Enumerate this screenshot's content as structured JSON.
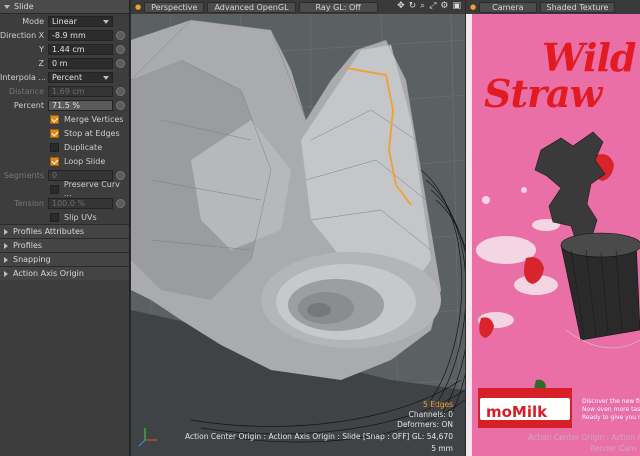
{
  "panel": {
    "title": "Slide",
    "mode": {
      "label": "Mode",
      "value": "Linear"
    },
    "direction": {
      "label": "Direction X",
      "x": "-8.9 mm",
      "y_label": "Y",
      "y": "1.44 cm",
      "z_label": "Z",
      "z": "0 m"
    },
    "interpolation": {
      "label": "Interpola ...",
      "value": "Percent"
    },
    "distance": {
      "label": "Distance",
      "value": "1.69 cm"
    },
    "percent": {
      "label": "Percent",
      "value": "71.5 %"
    },
    "checks": [
      {
        "label": "Merge Vertices",
        "checked": true
      },
      {
        "label": "Stop at Edges",
        "checked": true
      },
      {
        "label": "Duplicate",
        "checked": false
      },
      {
        "label": "Loop Slide",
        "checked": true
      }
    ],
    "segments": {
      "label": "Segments",
      "value": "0"
    },
    "preserve": {
      "label": "Preserve Curv ..."
    },
    "tension": {
      "label": "Tension",
      "value": "100.0 %"
    },
    "slip": {
      "label": "Slip UVs"
    },
    "sections": [
      "Profiles Attributes",
      "Profiles",
      "Snapping",
      "Action Axis Origin"
    ]
  },
  "viewport": {
    "tabs": [
      "Perspective",
      "Advanced OpenGL",
      "Ray GL: Off"
    ],
    "edges": "5 Edges",
    "channels": "Channels: 0",
    "deformers": "Deformers: ON",
    "status": "Action Center Origin : Action Axis Origin : Slide  [Snap : OFF]  GL: 54,670",
    "scale": "5 mm"
  },
  "viewport2": {
    "tabs": [
      "Camera",
      "Shaded Texture"
    ],
    "brand": "moMilk",
    "text_lines": [
      "Discover the new fi",
      "Now even more tast",
      "Ready to give you m"
    ],
    "status": "Action Center Origin : Action A",
    "camera": "Render Cam",
    "title_1": "Wild",
    "title_2": "Straw"
  }
}
